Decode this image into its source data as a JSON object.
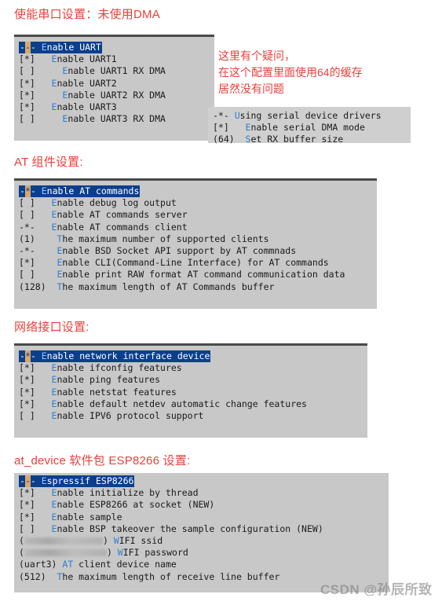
{
  "page": {
    "background": "#ffffff",
    "heading_color": "#e8413c",
    "panel_color": "#c8c8c8",
    "select_color": "#0b3f8c",
    "cursor_color": "#d9a86a",
    "hotkey_color": "#2f7fd0"
  },
  "sections": [
    {
      "heading": "使能串口设置：未使用DMA",
      "panel": {
        "lines": [
          {
            "prefix": "-",
            "cursor": "-",
            "suffix": "- ",
            "hot": "E",
            "rest": "nable UART",
            "selected": true
          },
          {
            "mark": "[*]   ",
            "hot": "E",
            "rest": "nable UART1",
            "selected": false
          },
          {
            "mark": "[ ]     ",
            "hot": "E",
            "rest": "nable UART1 RX DMA",
            "selected": false
          },
          {
            "mark": "[*]   ",
            "hot": "E",
            "rest": "nable UART2",
            "selected": false
          },
          {
            "mark": "[*]     ",
            "hot": "E",
            "rest": "nable UART2 RX DMA",
            "selected": false
          },
          {
            "mark": "[*]   ",
            "hot": "E",
            "rest": "nable UART3",
            "selected": false
          },
          {
            "mark": "[ ]     ",
            "hot": "E",
            "rest": "nable UART3 RX DMA",
            "selected": false
          }
        ]
      }
    },
    {
      "heading": "AT 组件设置:",
      "panel": {
        "lines": [
          {
            "prefix": "-",
            "cursor": "*",
            "suffix": "- ",
            "hot": "E",
            "rest": "nable AT commands",
            "selected": true
          },
          {
            "mark": "[ ]   ",
            "hot": "E",
            "rest": "nable debug log output",
            "selected": false
          },
          {
            "mark": "[ ]   ",
            "hot": "E",
            "rest": "nable AT commands server",
            "selected": false
          },
          {
            "mark": "-*-   ",
            "hot": "E",
            "rest": "nable AT commands client",
            "selected": false
          },
          {
            "mark": "(1)    ",
            "hot": "T",
            "rest": "he maximum number of supported clients",
            "selected": false
          },
          {
            "mark": "-*-    ",
            "hot": "E",
            "rest": "nable BSD Socket API support by AT commnads",
            "selected": false
          },
          {
            "mark": "[*]    ",
            "hot": "E",
            "rest": "nable CLI(Command-Line Interface) for AT commands",
            "selected": false
          },
          {
            "mark": "[ ]    ",
            "hot": "E",
            "rest": "nable print RAW format AT command communication data",
            "selected": false
          },
          {
            "mark": "(128)  ",
            "hot": "T",
            "rest": "he maximum length of AT Commands buffer",
            "selected": false
          }
        ]
      }
    },
    {
      "heading": "网络接口设置:",
      "panel": {
        "lines": [
          {
            "prefix": "-",
            "cursor": "*",
            "suffix": "- ",
            "hot": "E",
            "rest": "nable network interface device",
            "selected": true
          },
          {
            "mark": "[*]   ",
            "hot": "E",
            "rest": "nable ifconfig features",
            "selected": false
          },
          {
            "mark": "[*]   ",
            "hot": "E",
            "rest": "nable ping features",
            "selected": false
          },
          {
            "mark": "[*]   ",
            "hot": "E",
            "rest": "nable netstat features",
            "selected": false
          },
          {
            "mark": "[*]   ",
            "hot": "E",
            "rest": "nable default netdev automatic change features",
            "selected": false
          },
          {
            "mark": "[ ]   ",
            "hot": "E",
            "rest": "nable IPV6 protocol support",
            "selected": false
          }
        ]
      }
    },
    {
      "heading": "at_device 软件包 ESP8266 设置:",
      "panel": {
        "lines": [
          {
            "prefix": "-",
            "cursor": "-",
            "suffix": "- ",
            "hot": "E",
            "rest": "spressif ESP8266",
            "selected": true
          },
          {
            "mark": "[*]   ",
            "hot": "E",
            "rest": "nable initialize by thread",
            "selected": false
          },
          {
            "mark": "[*]   ",
            "hot": "E",
            "rest": "nable ESP8266 at socket (NEW)",
            "selected": false
          },
          {
            "mark": "[*]   ",
            "hot": "E",
            "rest": "nable sample",
            "selected": false
          },
          {
            "mark": "[ ]   ",
            "hot": "E",
            "rest": "nable BSP takeover the sample configuration (NEW)",
            "selected": false
          },
          {
            "mark": "(",
            "redact": 100,
            "mark2": ") ",
            "hot": "W",
            "rest": "IFI ssid",
            "selected": false
          },
          {
            "mark": "(",
            "redact": 105,
            "mark2": ") ",
            "hot": "W",
            "rest": "IFI password",
            "selected": false
          },
          {
            "mark": "(uart3) ",
            "hot": "AT",
            "rest": " client device name",
            "selected": false
          },
          {
            "mark": "(512)  ",
            "hot": "T",
            "rest": "he maximum length of receive line buffer",
            "selected": false
          }
        ]
      }
    }
  ],
  "note": {
    "line1": "这里有个疑问，",
    "line2": "在这个配置里面使用64的缓存",
    "line3": "居然没有问题"
  },
  "side_panel": {
    "lines": [
      {
        "mark": "-*- ",
        "hot": "U",
        "rest": "sing serial device drivers"
      },
      {
        "mark": "[*]   ",
        "hot": "E",
        "rest": "nable serial DMA mode"
      },
      {
        "mark": "(64)  ",
        "hot": "S",
        "rest": "et RX buffer size"
      }
    ]
  },
  "watermark": {
    "text": "CSDN @孙辰所致"
  }
}
